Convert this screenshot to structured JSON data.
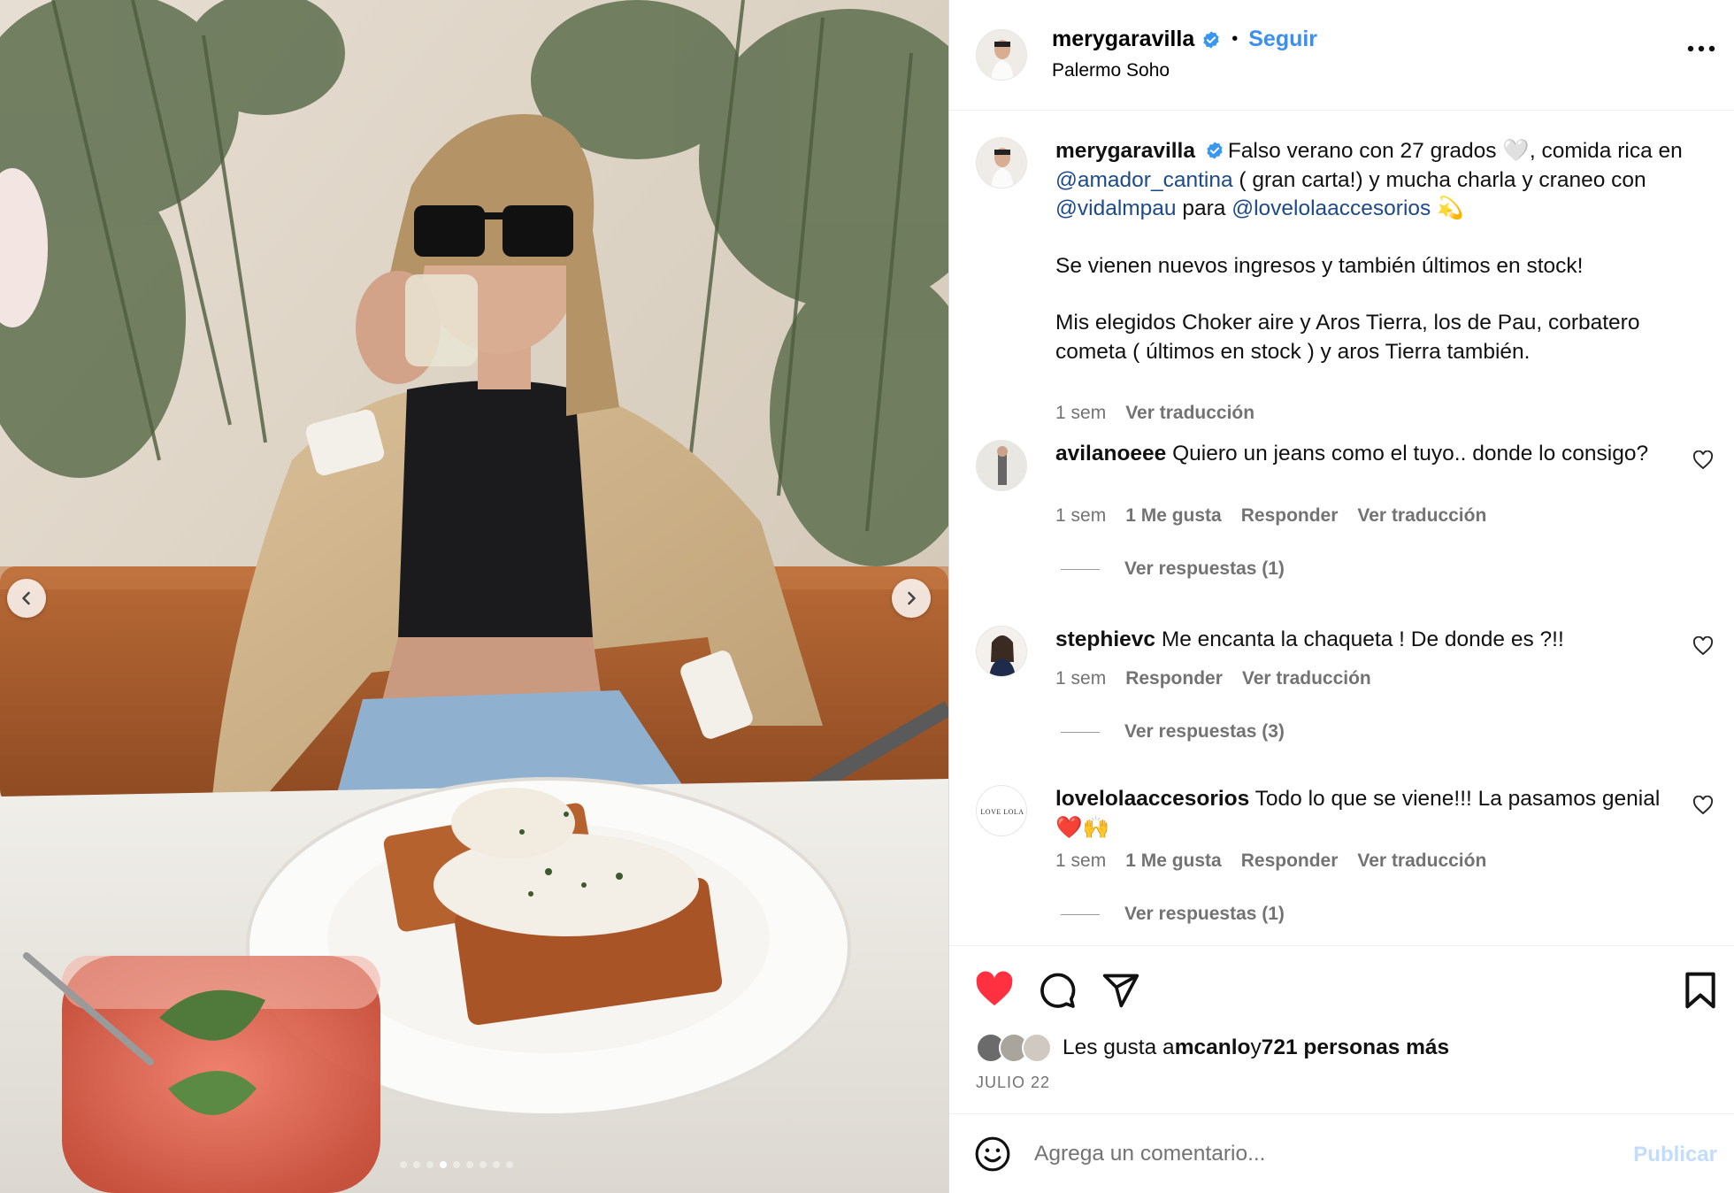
{
  "post": {
    "username": "merygaravilla",
    "follow_label": "Seguir",
    "separator": "•",
    "location": "Palermo Soho",
    "photo_alt": "Mujer con gafas de sol bebiendo en un restaurante con comida en primer plano",
    "carousel": {
      "total": 9,
      "active_index": 3
    }
  },
  "caption": {
    "username": "merygaravilla",
    "line1_text": "Falso verano con 27 grados 🤍, comida rica en ",
    "mention1": "@amador_cantina",
    "line1_text2": " ( gran carta!) y mucha charla y craneo con ",
    "mention2": "@vidalmpau",
    "line1_text3": " para ",
    "mention3": "@lovelolaaccesorios",
    "line1_emoji": " 💫",
    "para2": "Se vienen nuevos ingresos y también últimos en stock!",
    "para3": "Mis elegidos Choker aire y Aros Tierra, los de Pau, corbatero cometa ( últimos en stock ) y aros Tierra también.",
    "time": "1 sem",
    "translate": "Ver traducción"
  },
  "comments": [
    {
      "username": "avilanoeee",
      "text": "Quiero un jeans como el tuyo.. donde lo consigo?",
      "time": "1 sem",
      "likes": "1 Me gusta",
      "reply": "Responder",
      "translate": "Ver traducción",
      "replies": "Ver respuestas (1)"
    },
    {
      "username": "stephievc",
      "text": "Me encanta la chaqueta ! De donde es ?!!",
      "time": "1 sem",
      "reply": "Responder",
      "translate": "Ver traducción",
      "replies": "Ver respuestas (3)"
    },
    {
      "username": "lovelolaaccesorios",
      "text": "Todo lo que se viene!!! La pasamos genial ❤️🙌",
      "time": "1 sem",
      "likes": "1 Me gusta",
      "reply": "Responder",
      "translate": "Ver traducción",
      "replies": "Ver respuestas (1)",
      "avatar_text": "LOVE LOLA"
    }
  ],
  "likes": {
    "prefix": "Les gusta a ",
    "user": "mcanlo",
    "conj": " y ",
    "count": "721 personas más",
    "liked": true
  },
  "date": "JULIO 22",
  "composer": {
    "placeholder": "Agrega un comentario...",
    "value": "",
    "post_label": "Publicar"
  },
  "colors": {
    "accent": "#3a8ff0",
    "verified": "#3897f0",
    "heart": "#ff3040",
    "mention": "#1d4a8a",
    "muted": "#737373"
  },
  "icons": [
    "chevron-left-icon",
    "chevron-right-icon",
    "verified-icon",
    "more-icon",
    "heart-icon",
    "comment-icon",
    "share-icon",
    "bookmark-icon",
    "emoji-icon"
  ]
}
